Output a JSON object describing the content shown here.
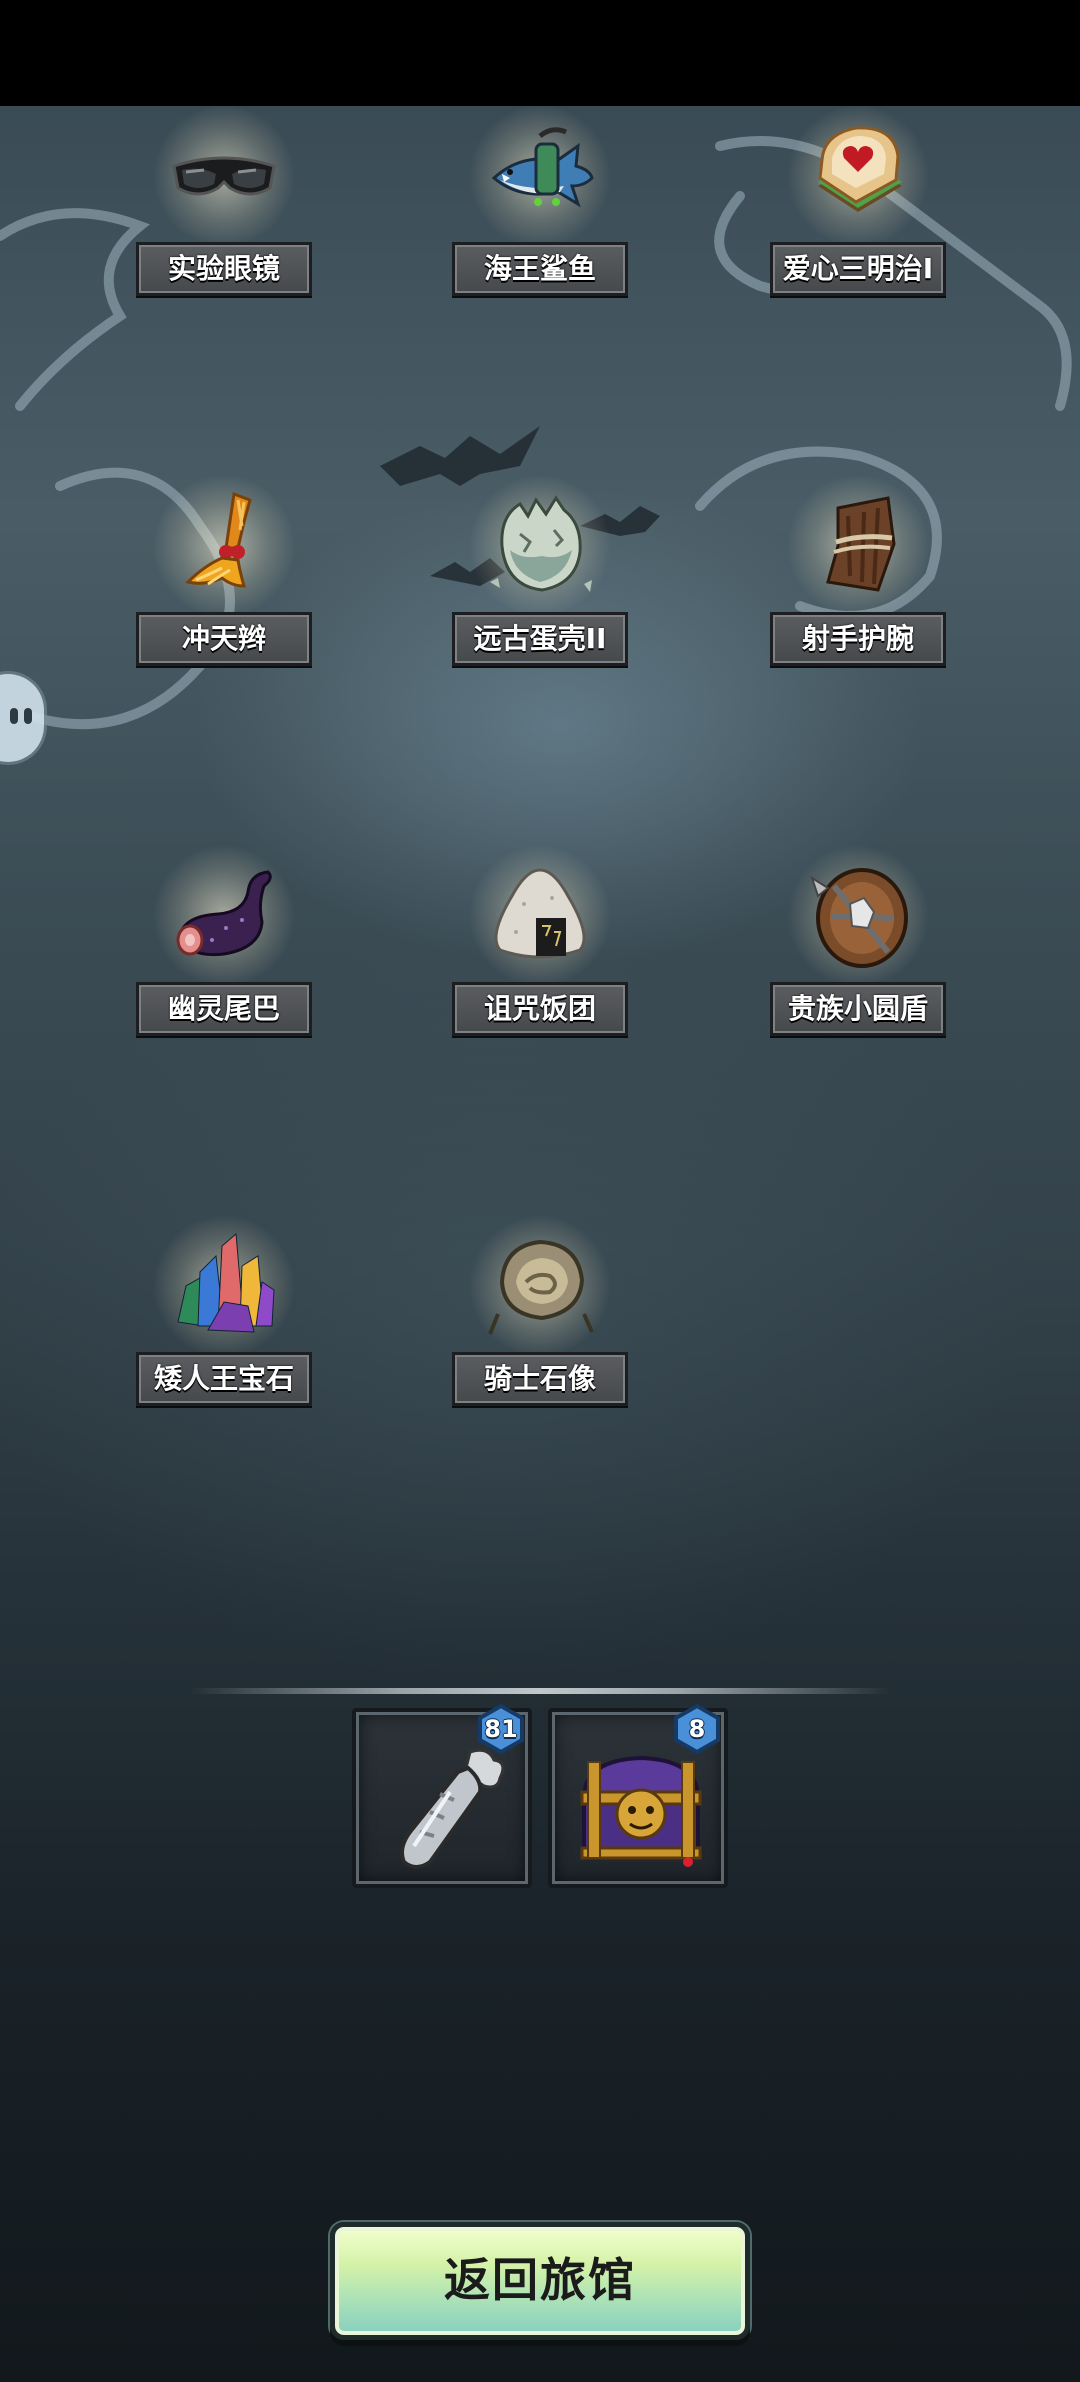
{
  "items": [
    {
      "id": "glasses",
      "label": "实验眼镜",
      "icon": "goggles-icon"
    },
    {
      "id": "shark",
      "label": "海王鲨鱼",
      "icon": "shark-icon"
    },
    {
      "id": "sandwich",
      "label": "爱心三明治I",
      "icon": "sandwich-icon"
    },
    {
      "id": "braid",
      "label": "冲天辫",
      "icon": "braid-icon"
    },
    {
      "id": "eggshell",
      "label": "远古蛋壳II",
      "icon": "eggshell-icon"
    },
    {
      "id": "bracer",
      "label": "射手护腕",
      "icon": "bracer-icon"
    },
    {
      "id": "tail",
      "label": "幽灵尾巴",
      "icon": "tail-icon"
    },
    {
      "id": "riceball",
      "label": "诅咒饭团",
      "icon": "riceball-icon"
    },
    {
      "id": "shield",
      "label": "贵族小圆盾",
      "icon": "shield-icon"
    },
    {
      "id": "gems",
      "label": "矮人王宝石",
      "icon": "gems-icon"
    },
    {
      "id": "statue",
      "label": "骑士石像",
      "icon": "stone-statue-icon"
    }
  ],
  "inventory": [
    {
      "id": "carrot",
      "icon": "silver-carrot-icon",
      "count": "81"
    },
    {
      "id": "chest",
      "icon": "treasure-chest-icon",
      "count": "8"
    }
  ],
  "back_button": {
    "label": "返回旅馆"
  },
  "colors": {
    "badge": "#4a90d9",
    "button_top": "#f4ffd0",
    "button_bottom": "#86cfc0"
  }
}
